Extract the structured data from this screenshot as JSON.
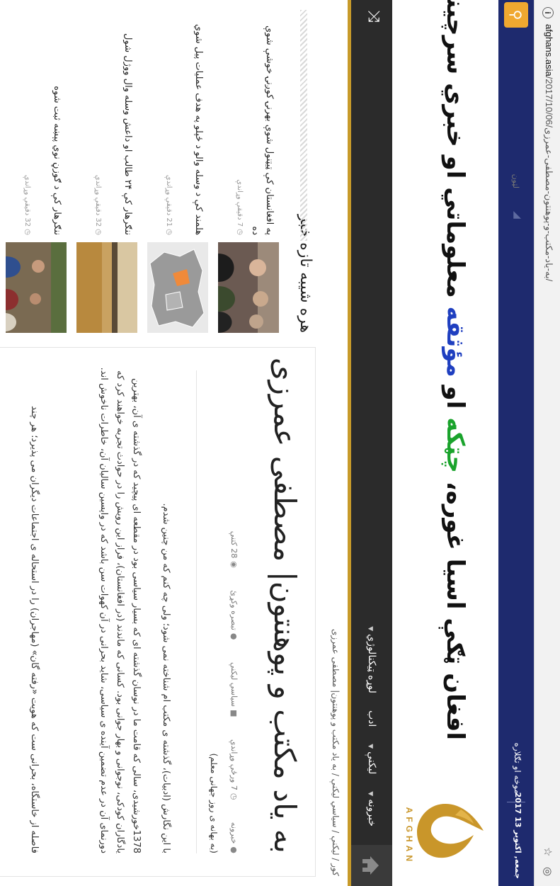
{
  "browser": {
    "url_host": "afghans.asia",
    "url_path": "/2017/10/06/به-یاد-مکتب-و-پوهنتون-مصطفی-عمرزی/"
  },
  "topbar": {
    "search_placeholder": "لټون",
    "links": "موخه او تګلاره",
    "date": "جمعه, اکتوبر 13 2017"
  },
  "masthead": {
    "tagline_part1": "افغان ټګې اسيا غوره، ",
    "tagline_green": "چټکه",
    "tagline_mid": " او ",
    "tagline_blue": "مؤثقه",
    "tagline_part2": " معلوماتي او خبري سرچينه",
    "logo_word": "AFGHAN"
  },
  "nav": {
    "items": [
      {
        "label": "خبرونه"
      },
      {
        "label": "ليکنې"
      },
      {
        "label": "ادب"
      },
      {
        "label": "لوړه ټيکنالوژي"
      }
    ]
  },
  "breadcrumb": "کور / ليکنې / سیاسي ليکنې / به یاد مکتب و پوهنتون| مصطفی عمرزی",
  "article": {
    "title": "به یاد مکتب و پوهنتون| مصطفی عمرزی",
    "meta": {
      "author": "خبرونه",
      "time": "7 ورځې وړاندې",
      "category": "سیاسي ليکنې",
      "comments": "تبصره وکړئ",
      "views": "28 کتنې"
    },
    "occasion": "(به بهانه ی روز جهانی معلم)",
    "paragraphs": [
      "با این نگارش (ادبیات)، گذشته ی مکتب ام شناخته نمی شود؛ ولی چه کنم که من چنین شدم.",
      "1378خورشیدی، سالی که قامت ما در نوسان گذشته ای که بسیار سیاسی بود در مقطعه ای پیچید که در گذشته ی آن، بهترین یادگاران کودکی، نوجوانی و بهار جوانی بود. کسانی که ماندند (در افغانستان)، فراز این رویش را در حوادث تجربه خواهند کرد که دورنمای آن در عدم تضمین آینده ی سیاسی، شاید بحرانی در آن کهوات سن باشد که در واپسین سالیان آن، خاطرات ناخوش اند.",
      "فاصله از خاستگاه، بحرانی ست که هویت «رفته گان» (مهاجران) را در استحاله ی اجتماعات دیگران می پذیرد؛ هر چند"
    ]
  },
  "sidebar": {
    "heading": "هره شيبه تازه خبر",
    "items": [
      {
        "title": "په افغانستان کې ټیټنول شوې بهرنۍ کوږنۍ خوشې شوې ده",
        "time": "7 دقيقې وړاندې",
        "thumb": "people"
      },
      {
        "title": "هلمند کې د وسله والو د ځپلو په هدف عملیات پیل شوي",
        "time": "21 دقيقې وړاندې",
        "thumb": "map"
      },
      {
        "title": "ننګرهار کې ۲۴ طالب او داعش وسله وال ووژل شول",
        "time": "32 دقيقې وړاندې",
        "thumb": "desert"
      },
      {
        "title": "ننګرهار کې د ګوزڼ نوي پېښه ثبت شوه",
        "time": "32 دقيقې وړاندې",
        "thumb": "field"
      }
    ]
  },
  "colors": {
    "navy": "#1e2a6e",
    "accent_orange": "#f0a830",
    "nav_dark": "#2b2b2b",
    "gold": "#c79a2a",
    "tag_green": "#1aa32c",
    "tag_blue": "#1f3fc0"
  }
}
